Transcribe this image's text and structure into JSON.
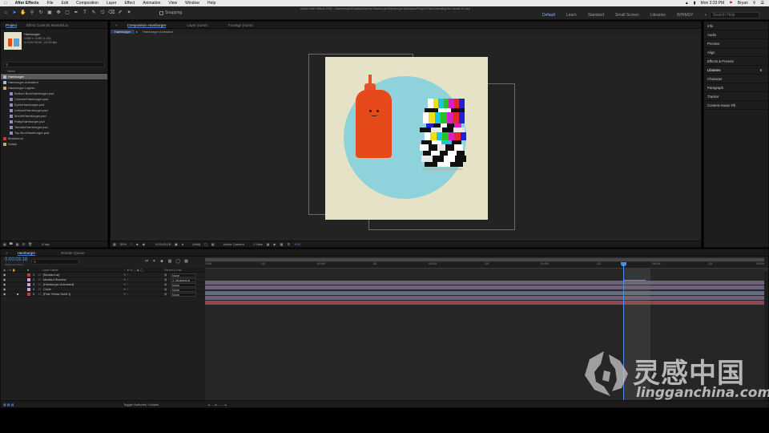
{
  "menubar": {
    "app_name": "After Effects",
    "items": [
      "File",
      "Edit",
      "Composition",
      "Layer",
      "Effect",
      "Animation",
      "View",
      "Window",
      "Help"
    ],
    "clock": "Mon 3:33 PM",
    "user": "Bryan"
  },
  "toolbar": {
    "snapping_label": "Snapping",
    "file_path": "Adobe After Effects 2020 - /Users/bryan/Desktop/Udemy Hamburger/Hamburger Animation/Project Files/Animating the Assets 01.aep",
    "workspaces": [
      "Default",
      "Learn",
      "Standard",
      "Small Screen",
      "Libraries",
      "WHIMSY"
    ],
    "active_workspace": "Default",
    "search_placeholder": "Search Help"
  },
  "project_panel": {
    "tab_project": "Project",
    "tab_effect_controls": "Effect Controls Mustard.ai",
    "item_name": "Hamburger",
    "item_info_1": "1080 x 1080 (1.00)",
    "item_info_2": "Δ 0;00;05;00, 24.00 fps",
    "column_name": "Name",
    "items": [
      {
        "label": "Hamburger",
        "type": "comp",
        "indent": 0,
        "selected": true
      },
      {
        "label": "Hamburger Animated",
        "type": "comp",
        "indent": 0,
        "selected": false
      },
      {
        "label": "Hamburger Layers",
        "type": "folder",
        "indent": 0,
        "selected": false
      },
      {
        "label": "Bottom Bun/Hamburger.psd",
        "type": "file",
        "indent": 1,
        "selected": false
      },
      {
        "label": "Cheese/Hamburger.psd",
        "type": "file",
        "indent": 1,
        "selected": false
      },
      {
        "label": "Eyes/Hamburger.psd",
        "type": "file",
        "indent": 1,
        "selected": false
      },
      {
        "label": "Lettuce/Hamburger.psd",
        "type": "file",
        "indent": 1,
        "selected": false
      },
      {
        "label": "Mouth/Hamburger.psd",
        "type": "file",
        "indent": 1,
        "selected": false
      },
      {
        "label": "Patty/Hamburger.psd",
        "type": "file",
        "indent": 1,
        "selected": false
      },
      {
        "label": "Tomato/Hamburger.psd",
        "type": "file",
        "indent": 1,
        "selected": false
      },
      {
        "label": "Top Bun/Hamburger.psd",
        "type": "file",
        "indent": 1,
        "selected": false
      },
      {
        "label": "Mustard.ai",
        "type": "ai",
        "indent": 0,
        "selected": false
      },
      {
        "label": "Solids",
        "type": "folder",
        "indent": 0,
        "selected": false
      }
    ],
    "footer_bpc": "8 bpc"
  },
  "composition_panel": {
    "tab_composition": "Composition Hamburger",
    "tab_layer": "Layer (none)",
    "tab_footage": "Footage (none)",
    "breadcrumbs": [
      "Hamburger",
      "Hamburger Animated"
    ],
    "zoom": "50%",
    "timecode": "0;00;03;18",
    "resolution": "(Half)",
    "camera": "Active Camera",
    "views": "1 View",
    "exposure": "+0.0"
  },
  "right_panel": {
    "items": [
      "Info",
      "Audio",
      "Preview",
      "Align",
      "Effects & Presets",
      "Libraries",
      "Character",
      "Paragraph",
      "Tracker",
      "Content-Aware Fill"
    ],
    "active_item": "Libraries"
  },
  "timeline": {
    "tab_comp": "Hamburger",
    "tab_render": "Render Queue",
    "current_time": "0:00:03:18",
    "frame_info": "00090 (24.00 fps)",
    "column_layer_name": "Layer Name",
    "column_parent": "Parent & Link",
    "layers": [
      {
        "num": "1",
        "name": "[Mustard.ai]",
        "color": "#c23a3a",
        "parent": "None"
      },
      {
        "num": "2",
        "name": "Mustard Shadow",
        "color": "#c9a9d8",
        "parent": "1. Mustard.ai"
      },
      {
        "num": "3",
        "name": "[Hamburger Animated]",
        "color": "#c9a9d8",
        "parent": "None"
      },
      {
        "num": "4",
        "name": "Circle",
        "color": "#c9a9d8",
        "parent": "None"
      },
      {
        "num": "5",
        "name": "[Pale Yellow Solid 1]",
        "color": "#c23a3a",
        "parent": "None"
      }
    ],
    "track_colors": [
      "#7a6b8a",
      "#7a6b8a",
      "#6e7a8e",
      "#7a6b8a",
      "#a54a5a"
    ],
    "ruler_labels": [
      "0:00f",
      "12f",
      "01:00f",
      "12f",
      "02:00f",
      "12f",
      "03:00f",
      "12f",
      "04:00f",
      "12f",
      "05:00f"
    ],
    "playhead_fraction": 0.748,
    "work_area_end_fraction": 0.796,
    "footer_label": "Toggle Switches / Modes"
  },
  "watermark": {
    "chinese_text": "灵感中国",
    "domain_text": "lingganchina.com"
  }
}
